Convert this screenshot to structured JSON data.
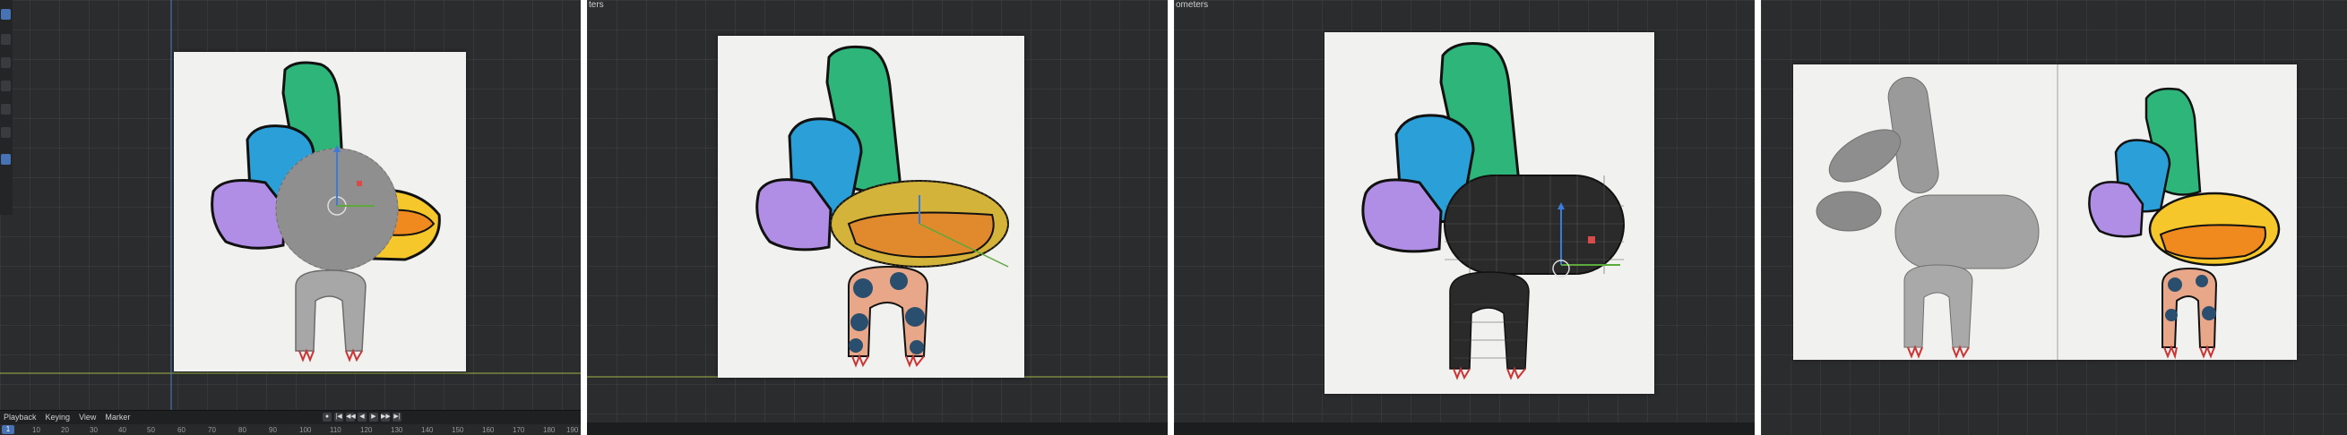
{
  "panels": [
    {
      "id": "viewport-1",
      "timeline": {
        "menu": [
          "Playback",
          "Keying",
          "View",
          "Marker"
        ],
        "current_frame": "1",
        "ruler_ticks": [
          "10",
          "20",
          "30",
          "40",
          "50",
          "60",
          "70",
          "80",
          "90",
          "100",
          "110",
          "120",
          "130",
          "140",
          "150",
          "160",
          "170",
          "180",
          "190"
        ]
      }
    },
    {
      "id": "viewport-2",
      "header_fragment": "ters"
    },
    {
      "id": "viewport-3",
      "header_fragment": "ometers"
    },
    {
      "id": "viewport-4"
    }
  ],
  "colors": {
    "viewport_bg": "#2b2c2e",
    "reference_sheet": "#f1f1ef",
    "green_feather": "#2db57a",
    "blue_feather": "#2a9fd8",
    "purple_feather": "#b18ee6",
    "yellow_beak": "#f5c72a",
    "orange_lips": "#f08a1e",
    "sculpt_grey": "#8f8f8f",
    "dark_mesh": "#2a2a2a",
    "skin_tan": "#e9a789",
    "selection_blue": "#4772b3"
  },
  "icons": [
    "cursor-icon",
    "move-icon",
    "rotate-icon",
    "scale-icon",
    "transform-icon",
    "annotate-icon",
    "measure-icon",
    "add-cube-icon"
  ]
}
